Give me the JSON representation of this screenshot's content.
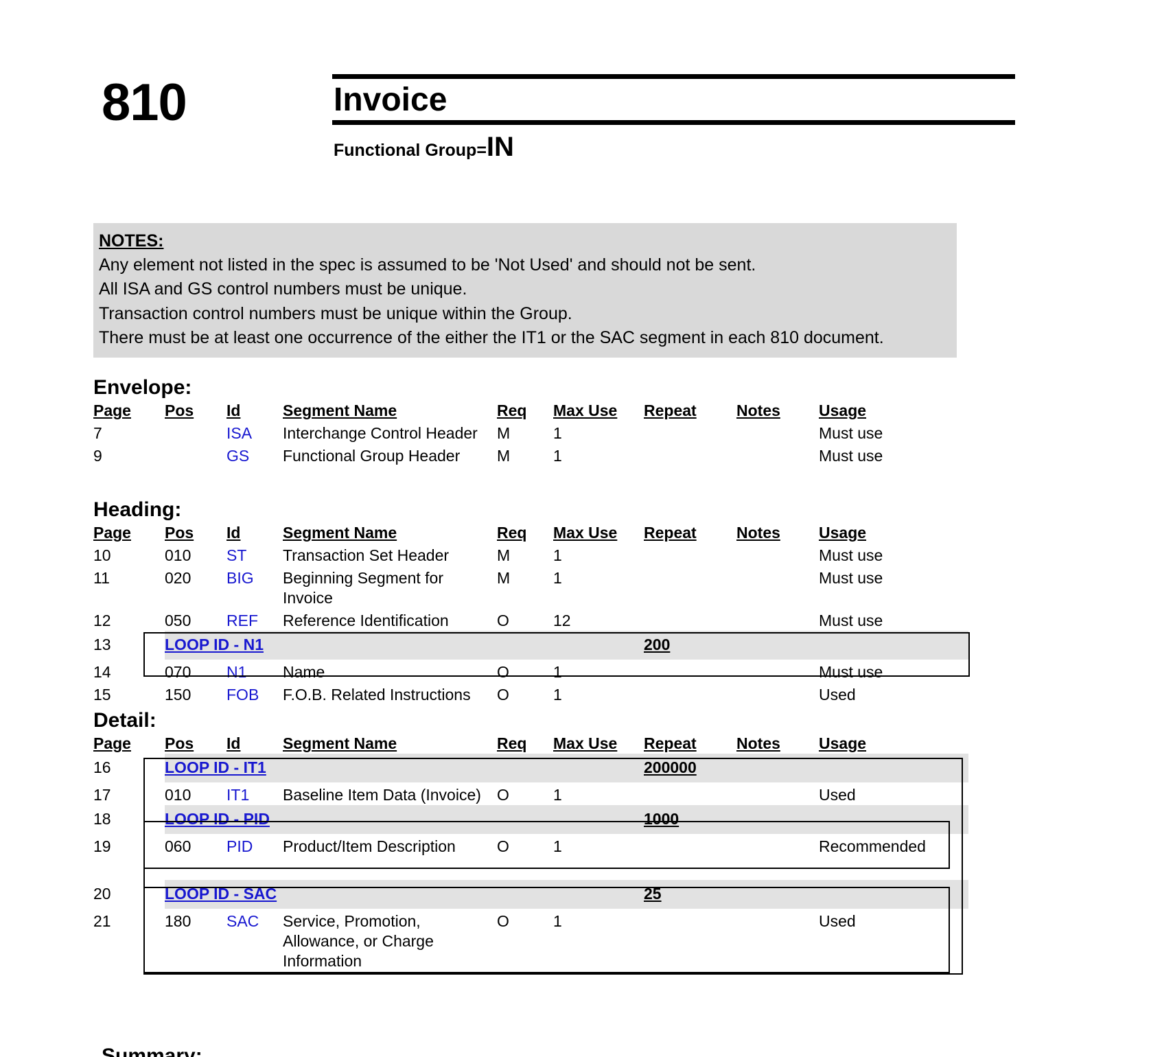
{
  "header": {
    "transaction_code": "810",
    "title": "Invoice",
    "functional_group_label": "Functional Group=",
    "functional_group_value": "IN"
  },
  "notes": {
    "title": "NOTES:",
    "lines": [
      "Any element not listed in the spec is assumed to be 'Not Used' and should not be sent.",
      "All ISA and GS control numbers must be unique.",
      "Transaction control numbers must be unique within the Group.",
      "There must be at least one occurrence of the either the IT1 or the SAC segment in each 810 document."
    ]
  },
  "columns": {
    "page": "Page",
    "pos": "Pos",
    "id": "Id",
    "segment_name": "Segment Name",
    "req": "Req",
    "max_use": "Max Use",
    "repeat": "Repeat",
    "notes": "Notes",
    "usage": "Usage"
  },
  "sections": [
    {
      "title": "Envelope:",
      "rows": [
        {
          "kind": "segment",
          "page": "7",
          "pos": "",
          "id": "ISA",
          "name": "Interchange Control Header",
          "req": "M",
          "max_use": "1",
          "repeat": "",
          "notes": "",
          "usage": "Must use"
        },
        {
          "kind": "segment",
          "page": "9",
          "pos": "",
          "id": "GS",
          "name": "Functional Group Header",
          "req": "M",
          "max_use": "1",
          "repeat": "",
          "notes": "",
          "usage": "Must use"
        }
      ]
    },
    {
      "title": "Heading:",
      "rows": [
        {
          "kind": "segment",
          "page": "10",
          "pos": "010",
          "id": "ST",
          "name": "Transaction Set Header",
          "req": "M",
          "max_use": "1",
          "repeat": "",
          "notes": "",
          "usage": "Must use"
        },
        {
          "kind": "segment",
          "page": "11",
          "pos": "020",
          "id": "BIG",
          "name": "Beginning Segment for Invoice",
          "req": "M",
          "max_use": "1",
          "repeat": "",
          "notes": "",
          "usage": "Must use"
        },
        {
          "kind": "segment",
          "page": "12",
          "pos": "050",
          "id": "REF",
          "name": "Reference Identification",
          "req": "O",
          "max_use": "12",
          "repeat": "",
          "notes": "",
          "usage": "Must use"
        },
        {
          "kind": "loop",
          "page": "13",
          "loop_label": "LOOP ID - N1",
          "repeat": "200"
        },
        {
          "kind": "segment",
          "page": "14",
          "pos": "070",
          "id": "N1",
          "name": "Name",
          "req": "O",
          "max_use": "1",
          "repeat": "",
          "notes": "",
          "usage": "Must use"
        },
        {
          "kind": "segment",
          "page": "15",
          "pos": "150",
          "id": "FOB",
          "name": "F.O.B. Related Instructions",
          "req": "O",
          "max_use": "1",
          "repeat": "",
          "notes": "",
          "usage": "Used"
        }
      ]
    },
    {
      "title": "Detail:",
      "rows": [
        {
          "kind": "loop",
          "page": "16",
          "loop_label": "LOOP ID - IT1",
          "repeat": "200000"
        },
        {
          "kind": "segment",
          "page": "17",
          "pos": "010",
          "id": "IT1",
          "name": "Baseline Item Data (Invoice)",
          "req": "O",
          "max_use": "1",
          "repeat": "",
          "notes": "",
          "usage": "Used"
        },
        {
          "kind": "loop",
          "page": "18",
          "loop_label": "LOOP ID - PID",
          "repeat": "1000"
        },
        {
          "kind": "segment",
          "page": "19",
          "pos": "060",
          "id": "PID",
          "name": "Product/Item Description",
          "req": "O",
          "max_use": "1",
          "repeat": "",
          "notes": "",
          "usage": "Recommended"
        },
        {
          "kind": "spacer"
        },
        {
          "kind": "loop",
          "page": "20",
          "loop_label": "LOOP ID - SAC",
          "repeat": "25"
        },
        {
          "kind": "segment",
          "page": "21",
          "pos": "180",
          "id": "SAC",
          "name": "Service, Promotion, Allowance, or Charge Information",
          "req": "O",
          "max_use": "1",
          "repeat": "",
          "notes": "",
          "usage": "Used"
        }
      ]
    }
  ]
}
